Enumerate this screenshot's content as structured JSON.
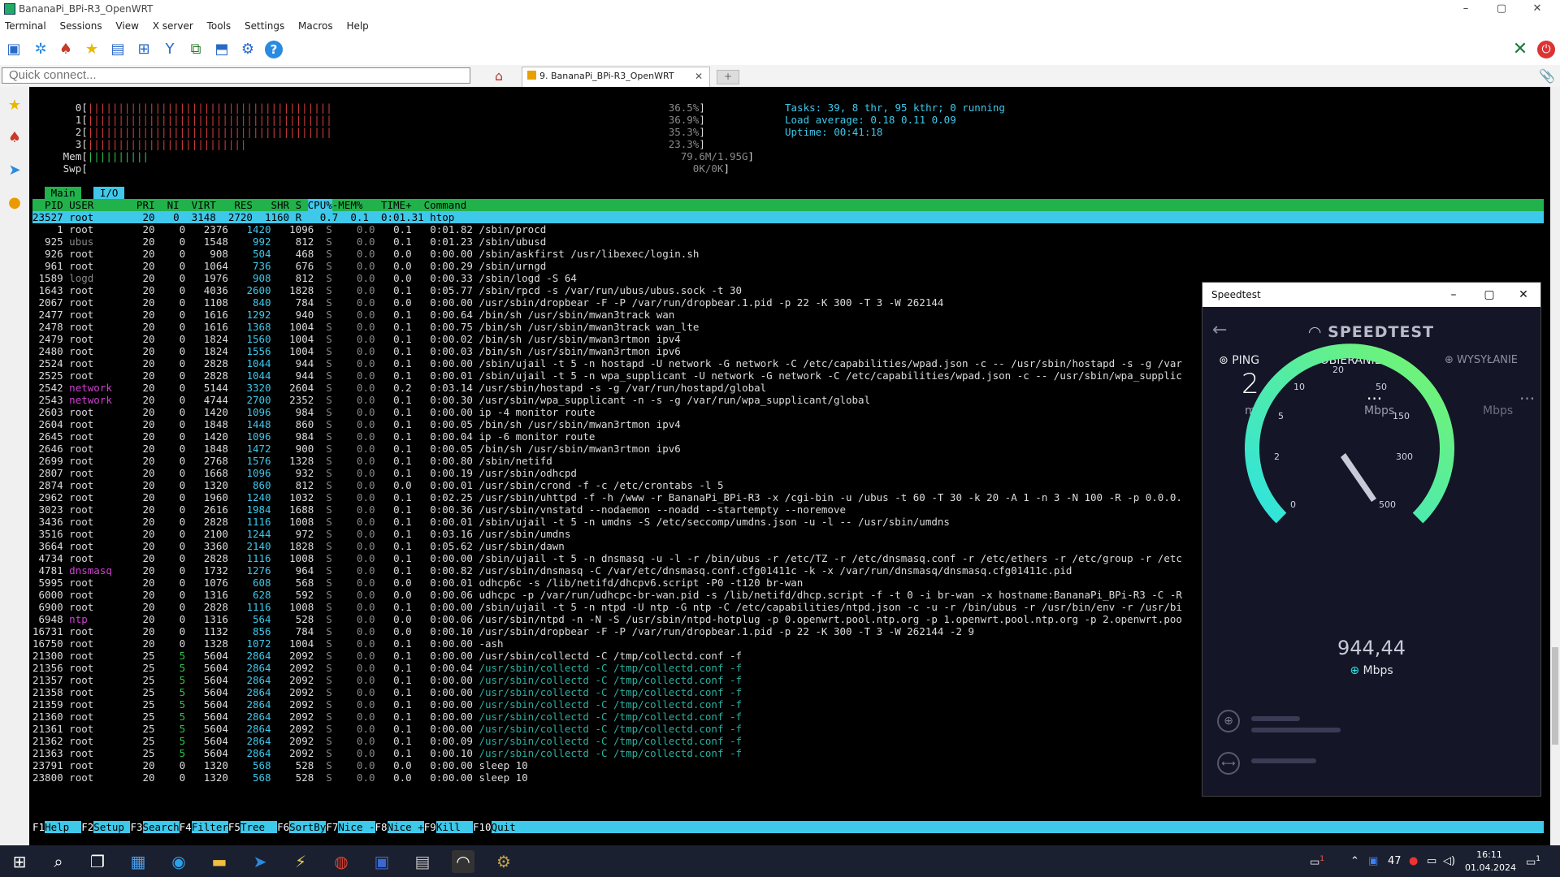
{
  "window": {
    "title": "BananaPi_BPi-R3_OpenWRT",
    "minimize": "–",
    "maximize": "▢",
    "close": "✕"
  },
  "menu": [
    "Terminal",
    "Sessions",
    "View",
    "X server",
    "Tools",
    "Settings",
    "Macros",
    "Help"
  ],
  "quickconnect": {
    "placeholder": "Quick connect..."
  },
  "session_tab": {
    "label": "9. BananaPi_BPi-R3_OpenWRT",
    "close": "✕",
    "new_tab": "+"
  },
  "htop": {
    "cpu_bars": [
      {
        "id": "0",
        "bar": "||||||||||||||||||||||||||||||||||||||||",
        "pct": "36.5%"
      },
      {
        "id": "1",
        "bar": "||||||||||||||||||||||||||||||||||||||||",
        "pct": "36.9%"
      },
      {
        "id": "2",
        "bar": "||||||||||||||||||||||||||||||||||||||||",
        "pct": "35.3%"
      },
      {
        "id": "3",
        "bar": "||||||||||||||||||||||||||",
        "pct": "23.3%"
      }
    ],
    "mem": {
      "label": "Mem",
      "bar": "||||||||||",
      "value": "79.6M/1.95G"
    },
    "swp": {
      "label": "Swp",
      "value": "0K/0K"
    },
    "tasks_line": "Tasks: 39, 8 thr, 95 kthr; 0 running",
    "load_line": "Load average: 0.18 0.11 0.09",
    "uptime_line": "Uptime: 00:41:18",
    "tabs": [
      "Main",
      "I/O"
    ],
    "header_pre": "  PID USER       PRI  NI  VIRT   RES   SHR S ",
    "header_cpu": "CPU%",
    "header_post": "-MEM%   TIME+  Command",
    "selected_row": "23527 root        20   0  3148  2720  1160 R   0.7  0.1  0:01.31 htop",
    "rows": [
      [
        "    1",
        "root",
        "20",
        "0",
        "2376",
        "1420",
        "1096",
        "S",
        "0.0",
        "0.1",
        "0:01.82",
        "/sbin/procd"
      ],
      [
        "  925",
        "ubus",
        "20",
        "0",
        "1548",
        "992",
        "812",
        "S",
        "0.0",
        "0.1",
        "0:01.23",
        "/sbin/ubusd"
      ],
      [
        "  926",
        "root",
        "20",
        "0",
        "908",
        "504",
        "468",
        "S",
        "0.0",
        "0.0",
        "0:00.00",
        "/sbin/askfirst /usr/libexec/login.sh"
      ],
      [
        "  961",
        "root",
        "20",
        "0",
        "1064",
        "736",
        "676",
        "S",
        "0.0",
        "0.0",
        "0:00.29",
        "/sbin/urngd"
      ],
      [
        " 1589",
        "logd",
        "20",
        "0",
        "1976",
        "908",
        "812",
        "S",
        "0.0",
        "0.0",
        "0:00.33",
        "/sbin/logd -S 64"
      ],
      [
        " 1643",
        "root",
        "20",
        "0",
        "4036",
        "2600",
        "1828",
        "S",
        "0.0",
        "0.1",
        "0:05.77",
        "/sbin/rpcd -s /var/run/ubus/ubus.sock -t 30"
      ],
      [
        " 2067",
        "root",
        "20",
        "0",
        "1108",
        "840",
        "784",
        "S",
        "0.0",
        "0.0",
        "0:00.00",
        "/usr/sbin/dropbear -F -P /var/run/dropbear.1.pid -p 22 -K 300 -T 3 -W 262144"
      ],
      [
        " 2477",
        "root",
        "20",
        "0",
        "1616",
        "1292",
        "940",
        "S",
        "0.0",
        "0.1",
        "0:00.64",
        "/bin/sh /usr/sbin/mwan3track wan"
      ],
      [
        " 2478",
        "root",
        "20",
        "0",
        "1616",
        "1368",
        "1004",
        "S",
        "0.0",
        "0.1",
        "0:00.75",
        "/bin/sh /usr/sbin/mwan3track wan_lte"
      ],
      [
        " 2479",
        "root",
        "20",
        "0",
        "1824",
        "1560",
        "1004",
        "S",
        "0.0",
        "0.1",
        "0:00.02",
        "/bin/sh /usr/sbin/mwan3rtmon ipv4"
      ],
      [
        " 2480",
        "root",
        "20",
        "0",
        "1824",
        "1556",
        "1004",
        "S",
        "0.0",
        "0.1",
        "0:00.03",
        "/bin/sh /usr/sbin/mwan3rtmon ipv6"
      ],
      [
        " 2524",
        "root",
        "20",
        "0",
        "2828",
        "1044",
        "944",
        "S",
        "0.0",
        "0.1",
        "0:00.00",
        "/sbin/ujail -t 5 -n hostapd -U network -G network -C /etc/capabilities/wpad.json -c -- /usr/sbin/hostapd -s -g /var"
      ],
      [
        " 2525",
        "root",
        "20",
        "0",
        "2828",
        "1044",
        "944",
        "S",
        "0.0",
        "0.1",
        "0:00.01",
        "/sbin/ujail -t 5 -n wpa_supplicant -U network -G network -C /etc/capabilities/wpad.json -c -- /usr/sbin/wpa_supplic"
      ],
      [
        " 2542",
        "network",
        "20",
        "0",
        "5144",
        "3320",
        "2604",
        "S",
        "0.0",
        "0.2",
        "0:03.14",
        "/usr/sbin/hostapd -s -g /var/run/hostapd/global"
      ],
      [
        " 2543",
        "network",
        "20",
        "0",
        "4744",
        "2700",
        "2352",
        "S",
        "0.0",
        "0.1",
        "0:00.30",
        "/usr/sbin/wpa_supplicant -n -s -g /var/run/wpa_supplicant/global"
      ],
      [
        " 2603",
        "root",
        "20",
        "0",
        "1420",
        "1096",
        "984",
        "S",
        "0.0",
        "0.1",
        "0:00.00",
        "ip -4 monitor route"
      ],
      [
        " 2604",
        "root",
        "20",
        "0",
        "1848",
        "1448",
        "860",
        "S",
        "0.0",
        "0.1",
        "0:00.05",
        "/bin/sh /usr/sbin/mwan3rtmon ipv4"
      ],
      [
        " 2645",
        "root",
        "20",
        "0",
        "1420",
        "1096",
        "984",
        "S",
        "0.0",
        "0.1",
        "0:00.04",
        "ip -6 monitor route"
      ],
      [
        " 2646",
        "root",
        "20",
        "0",
        "1848",
        "1472",
        "900",
        "S",
        "0.0",
        "0.1",
        "0:00.05",
        "/bin/sh /usr/sbin/mwan3rtmon ipv6"
      ],
      [
        " 2699",
        "root",
        "20",
        "0",
        "2768",
        "1576",
        "1328",
        "S",
        "0.0",
        "0.1",
        "0:00.80",
        "/sbin/netifd"
      ],
      [
        " 2807",
        "root",
        "20",
        "0",
        "1668",
        "1096",
        "932",
        "S",
        "0.0",
        "0.1",
        "0:00.19",
        "/usr/sbin/odhcpd"
      ],
      [
        " 2874",
        "root",
        "20",
        "0",
        "1320",
        "860",
        "812",
        "S",
        "0.0",
        "0.0",
        "0:00.01",
        "/usr/sbin/crond -f -c /etc/crontabs -l 5"
      ],
      [
        " 2962",
        "root",
        "20",
        "0",
        "1960",
        "1240",
        "1032",
        "S",
        "0.0",
        "0.1",
        "0:02.25",
        "/usr/sbin/uhttpd -f -h /www -r BananaPi_BPi-R3 -x /cgi-bin -u /ubus -t 60 -T 30 -k 20 -A 1 -n 3 -N 100 -R -p 0.0.0."
      ],
      [
        " 3023",
        "root",
        "20",
        "0",
        "2616",
        "1984",
        "1688",
        "S",
        "0.0",
        "0.1",
        "0:00.36",
        "/usr/sbin/vnstatd --nodaemon --noadd --startempty --noremove"
      ],
      [
        " 3436",
        "root",
        "20",
        "0",
        "2828",
        "1116",
        "1008",
        "S",
        "0.0",
        "0.1",
        "0:00.01",
        "/sbin/ujail -t 5 -n umdns -S /etc/seccomp/umdns.json -u -l -- /usr/sbin/umdns"
      ],
      [
        " 3516",
        "root",
        "20",
        "0",
        "2100",
        "1244",
        "972",
        "S",
        "0.0",
        "0.1",
        "0:03.16",
        "/usr/sbin/umdns"
      ],
      [
        " 3664",
        "root",
        "20",
        "0",
        "3360",
        "2140",
        "1828",
        "S",
        "0.0",
        "0.1",
        "0:05.62",
        "/usr/sbin/dawn"
      ],
      [
        " 4734",
        "root",
        "20",
        "0",
        "2828",
        "1116",
        "1008",
        "S",
        "0.0",
        "0.1",
        "0:00.00",
        "/sbin/ujail -t 5 -n dnsmasq -u -l -r /bin/ubus -r /etc/TZ -r /etc/dnsmasq.conf -r /etc/ethers -r /etc/group -r /etc"
      ],
      [
        " 4781",
        "dnsmasq",
        "20",
        "0",
        "1732",
        "1276",
        "964",
        "S",
        "0.0",
        "0.1",
        "0:00.82",
        "/usr/sbin/dnsmasq -C /var/etc/dnsmasq.conf.cfg01411c -k -x /var/run/dnsmasq/dnsmasq.cfg01411c.pid"
      ],
      [
        " 5995",
        "root",
        "20",
        "0",
        "1076",
        "608",
        "568",
        "S",
        "0.0",
        "0.0",
        "0:00.01",
        "odhcp6c -s /lib/netifd/dhcpv6.script -P0 -t120 br-wan"
      ],
      [
        " 6000",
        "root",
        "20",
        "0",
        "1316",
        "628",
        "592",
        "S",
        "0.0",
        "0.0",
        "0:00.06",
        "udhcpc -p /var/run/udhcpc-br-wan.pid -s /lib/netifd/dhcp.script -f -t 0 -i br-wan -x hostname:BananaPi_BPi-R3 -C -R"
      ],
      [
        " 6900",
        "root",
        "20",
        "0",
        "2828",
        "1116",
        "1008",
        "S",
        "0.0",
        "0.1",
        "0:00.00",
        "/sbin/ujail -t 5 -n ntpd -U ntp -G ntp -C /etc/capabilities/ntpd.json -c -u -r /bin/ubus -r /usr/bin/env -r /usr/bi"
      ],
      [
        " 6948",
        "ntp",
        "20",
        "0",
        "1316",
        "564",
        "528",
        "S",
        "0.0",
        "0.0",
        "0:00.06",
        "/usr/sbin/ntpd -n -N -S /usr/sbin/ntpd-hotplug -p 0.openwrt.pool.ntp.org -p 1.openwrt.pool.ntp.org -p 2.openwrt.poo"
      ],
      [
        "16731",
        "root",
        "20",
        "0",
        "1132",
        "856",
        "784",
        "S",
        "0.0",
        "0.0",
        "0:00.10",
        "/usr/sbin/dropbear -F -P /var/run/dropbear.1.pid -p 22 -K 300 -T 3 -W 262144 -2 9"
      ],
      [
        "16750",
        "root",
        "20",
        "0",
        "1328",
        "1072",
        "1004",
        "S",
        "0.0",
        "0.1",
        "0:00.00",
        "-ash"
      ],
      [
        "21300",
        "root",
        "25",
        "5",
        "5604",
        "2864",
        "2092",
        "S",
        "0.0",
        "0.1",
        "0:00.00",
        "/usr/sbin/collectd -C /tmp/collectd.conf -f"
      ],
      [
        "21356",
        "root",
        "25",
        "5",
        "5604",
        "2864",
        "2092",
        "S",
        "0.0",
        "0.1",
        "0:00.04",
        "/usr/sbin/collectd -C /tmp/collectd.conf -f"
      ],
      [
        "21357",
        "root",
        "25",
        "5",
        "5604",
        "2864",
        "2092",
        "S",
        "0.0",
        "0.1",
        "0:00.00",
        "/usr/sbin/collectd -C /tmp/collectd.conf -f"
      ],
      [
        "21358",
        "root",
        "25",
        "5",
        "5604",
        "2864",
        "2092",
        "S",
        "0.0",
        "0.1",
        "0:00.00",
        "/usr/sbin/collectd -C /tmp/collectd.conf -f"
      ],
      [
        "21359",
        "root",
        "25",
        "5",
        "5604",
        "2864",
        "2092",
        "S",
        "0.0",
        "0.1",
        "0:00.00",
        "/usr/sbin/collectd -C /tmp/collectd.conf -f"
      ],
      [
        "21360",
        "root",
        "25",
        "5",
        "5604",
        "2864",
        "2092",
        "S",
        "0.0",
        "0.1",
        "0:00.00",
        "/usr/sbin/collectd -C /tmp/collectd.conf -f"
      ],
      [
        "21361",
        "root",
        "25",
        "5",
        "5604",
        "2864",
        "2092",
        "S",
        "0.0",
        "0.1",
        "0:00.00",
        "/usr/sbin/collectd -C /tmp/collectd.conf -f"
      ],
      [
        "21362",
        "root",
        "25",
        "5",
        "5604",
        "2864",
        "2092",
        "S",
        "0.0",
        "0.1",
        "0:00.09",
        "/usr/sbin/collectd -C /tmp/collectd.conf -f"
      ],
      [
        "21363",
        "root",
        "25",
        "5",
        "5604",
        "2864",
        "2092",
        "S",
        "0.0",
        "0.1",
        "0:00.10",
        "/usr/sbin/collectd -C /tmp/collectd.conf -f"
      ],
      [
        "23791",
        "root",
        "20",
        "0",
        "1320",
        "568",
        "528",
        "S",
        "0.0",
        "0.0",
        "0:00.00",
        "sleep 10"
      ],
      [
        "23800",
        "root",
        "20",
        "0",
        "1320",
        "568",
        "528",
        "S",
        "0.0",
        "0.0",
        "0:00.00",
        "sleep 10"
      ]
    ],
    "fkeys": [
      [
        "F1",
        "Help  "
      ],
      [
        "F2",
        "Setup "
      ],
      [
        "F3",
        "Search"
      ],
      [
        "F4",
        "Filter"
      ],
      [
        "F5",
        "Tree  "
      ],
      [
        "F6",
        "SortBy"
      ],
      [
        "F7",
        "Nice -"
      ],
      [
        "F8",
        "Nice +"
      ],
      [
        "F9",
        "Kill  "
      ],
      [
        "F10",
        "Quit  "
      ]
    ]
  },
  "speedtest": {
    "title": "Speedtest",
    "brand": "SPEEDTEST",
    "ping_label": "PING",
    "ping_value": "2",
    "ping_unit": "ms",
    "download_label": "POBIERANIE",
    "download_value": "...",
    "download_unit": "Mbps",
    "upload_label": "WYSYŁANIE",
    "upload_value": "...",
    "upload_unit": "Mbps",
    "gauge_ticks": [
      "0",
      "2",
      "5",
      "10",
      "20",
      "50",
      "150",
      "300",
      "500"
    ],
    "current_speed": "944,44",
    "current_unit": "Mbps"
  },
  "taskbar": {
    "badge": "1",
    "tray_count": "47",
    "time": "16:11",
    "date": "01.04.2024",
    "notif": "1"
  },
  "colors": {
    "htop_green": "#22b24c",
    "htop_cyan": "#3ec8ea",
    "speedtest_bg": "#141526",
    "gauge_start": "#2ee3e0",
    "gauge_end": "#78f56a"
  }
}
